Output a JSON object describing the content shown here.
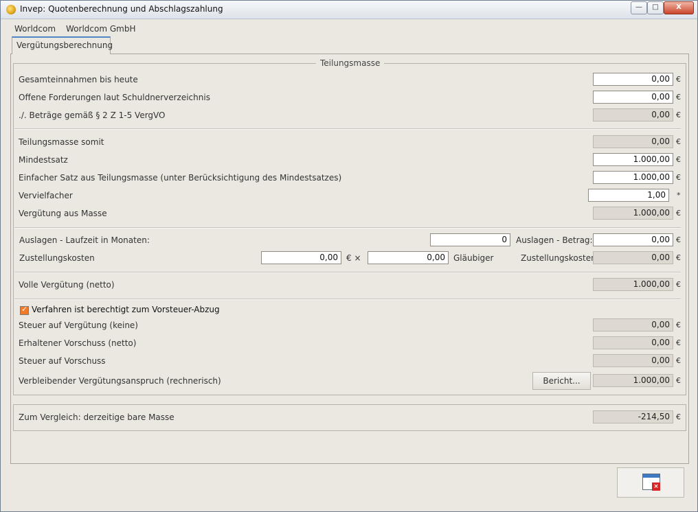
{
  "window": {
    "title": "Invep: Quotenberechnung und Abschlagszahlung",
    "min_label": "—",
    "max_label": "□",
    "close_label": "X"
  },
  "menu": {
    "items": [
      "Worldcom",
      "Worldcom GmbH"
    ]
  },
  "tab": {
    "label": "Vergütungsberechnung"
  },
  "group": {
    "title": "Teilungsmasse"
  },
  "rows": {
    "gesamteinnahmen": {
      "label": "Gesamteinnahmen bis heute",
      "value": "0,00",
      "unit": "€"
    },
    "offene_forderungen": {
      "label": "Offene Forderungen laut Schuldnerverzeichnis",
      "value": "0,00",
      "unit": "€"
    },
    "betraege": {
      "label": "./. Beträge gemäß § 2 Z 1-5 VergVO",
      "value": "0,00",
      "unit": "€"
    },
    "teilungsmasse_somit": {
      "label": "Teilungsmasse somit",
      "value": "0,00",
      "unit": "€"
    },
    "mindestsatz": {
      "label": "Mindestsatz",
      "value": "1.000,00",
      "unit": "€"
    },
    "einfacher_satz": {
      "label": "Einfacher Satz aus Teilungsmasse (unter Berücksichtigung des Mindestsatzes)",
      "value": "1.000,00",
      "unit": "€"
    },
    "vervielfacher": {
      "label": "Vervielfacher",
      "value": "1,00",
      "unit": "*"
    },
    "verguetung_masse": {
      "label": "Vergütung aus Masse",
      "value": "1.000,00",
      "unit": "€"
    },
    "auslagen_laufzeit": {
      "label": "Auslagen - Laufzeit in Monaten:",
      "value": "0"
    },
    "auslagen_betrag": {
      "label": "Auslagen - Betrag:",
      "value": "0,00",
      "unit": "€"
    },
    "zustellung": {
      "label": "Zustellungskosten",
      "value1": "0,00",
      "times": "€ ×",
      "value2": "0,00",
      "glaeubiger": "Gläubiger",
      "result_label": "Zustellungskosten",
      "result": "0,00",
      "unit": "€"
    },
    "volle_verguetung": {
      "label": "Volle Vergütung (netto)",
      "value": "1.000,00",
      "unit": "€"
    },
    "vorsteuer": {
      "label": "Verfahren ist berechtigt zum Vorsteuer-Abzug",
      "checked": true
    },
    "steuer_verguetung": {
      "label": "Steuer auf Vergütung (keine)",
      "value": "0,00",
      "unit": "€"
    },
    "erhaltener_vorschuss": {
      "label": "Erhaltener Vorschuss (netto)",
      "value": "0,00",
      "unit": "€"
    },
    "steuer_vorschuss": {
      "label": "Steuer auf Vorschuss",
      "value": "0,00",
      "unit": "€"
    },
    "verbleibend": {
      "label": "Verbleibender Vergütungsanspruch (rechnerisch)",
      "button": "Bericht...",
      "value": "1.000,00",
      "unit": "€"
    },
    "vergleich": {
      "label": "Zum Vergleich: derzeitige bare Masse",
      "value": "-214,50",
      "unit": "€"
    }
  },
  "colors": {
    "accent": "#4e86c6",
    "checkbox": "#ee7a2a",
    "panel": "#ebe8e2"
  }
}
